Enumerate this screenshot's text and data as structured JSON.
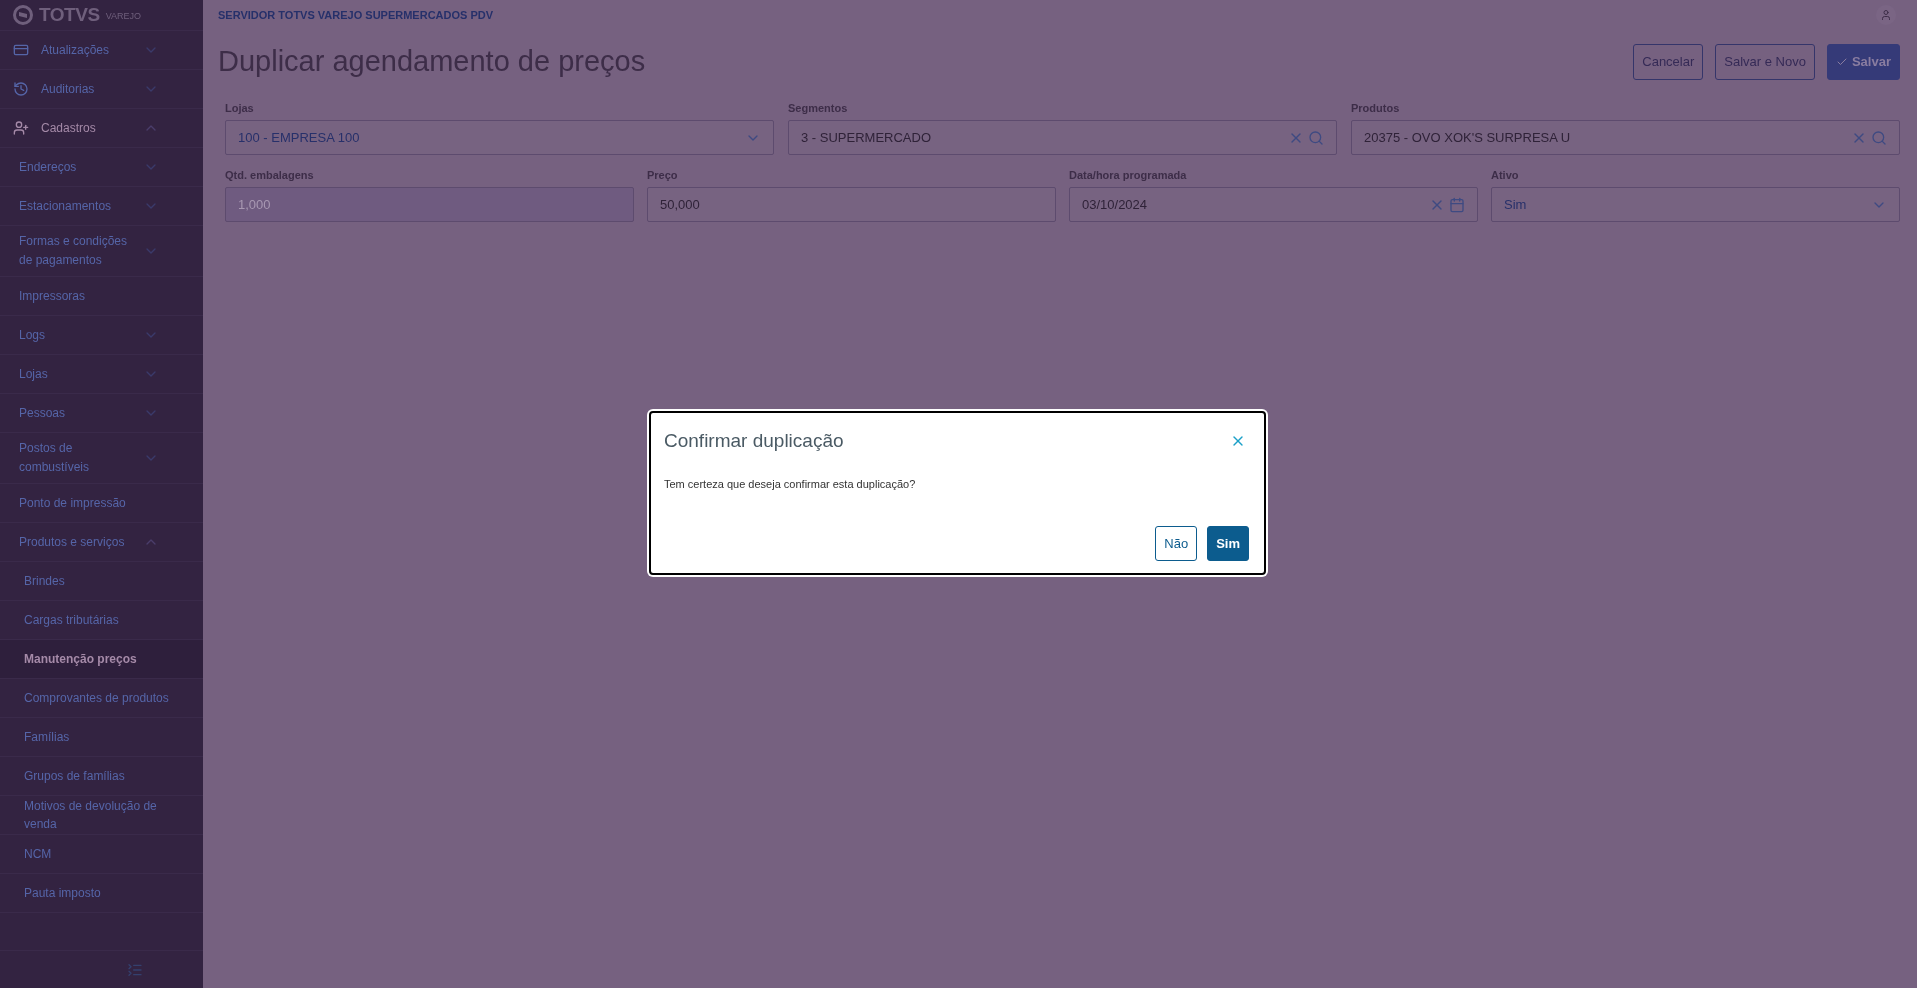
{
  "brand": {
    "name": "TOTVS",
    "product": "VAREJO"
  },
  "sidebar": {
    "items": [
      {
        "label": "Atualizações",
        "kind": "group",
        "expanded": false
      },
      {
        "label": "Auditorias",
        "kind": "group",
        "expanded": false
      },
      {
        "label": "Cadastros",
        "kind": "group",
        "expanded": true,
        "children": [
          {
            "label": "Endereços",
            "expanded": false
          },
          {
            "label": "Estacionamentos",
            "expanded": false
          },
          {
            "label": "Formas e condições de pagamentos",
            "expanded": false
          },
          {
            "label": "Impressoras"
          },
          {
            "label": "Logs",
            "expanded": false
          },
          {
            "label": "Lojas",
            "expanded": false
          },
          {
            "label": "Pessoas",
            "expanded": false
          },
          {
            "label": "Postos de combustíveis",
            "expanded": false
          },
          {
            "label": "Ponto de impressão"
          },
          {
            "label": "Produtos e serviços",
            "expanded": true,
            "children": [
              {
                "label": "Brindes",
                "selected": false
              },
              {
                "label": "Cargas tributárias",
                "selected": false
              },
              {
                "label": "Manutenção preços",
                "selected": true
              },
              {
                "label": "Comprovantes de produtos",
                "selected": false
              },
              {
                "label": "Famílias",
                "selected": false
              },
              {
                "label": "Grupos de famílias",
                "selected": false
              },
              {
                "label": "Motivos de devolução de venda",
                "selected": false
              },
              {
                "label": "NCM",
                "selected": false
              },
              {
                "label": "Pauta imposto",
                "selected": false
              }
            ]
          }
        ]
      }
    ]
  },
  "header": {
    "server": "SERVIDOR TOTVS VAREJO SUPERMERCADOS PDV"
  },
  "page": {
    "title": "Duplicar agendamento de preços",
    "buttons": [
      {
        "label": "Cancelar",
        "kind": "secondary"
      },
      {
        "label": "Salvar e Novo",
        "kind": "secondary"
      },
      {
        "label": "Salvar",
        "kind": "primary"
      }
    ]
  },
  "form": {
    "filters": [
      {
        "label": "Lojas",
        "value": "100 - EMPRESA 100",
        "kind": "select",
        "disabled": false
      },
      {
        "label": "Segmentos",
        "value": "3 - SUPERMERCADO",
        "kind": "lookup",
        "disabled": false
      },
      {
        "label": "Produtos",
        "value": "20375 - OVO XOK'S SURPRESA U",
        "kind": "lookup",
        "disabled": false
      }
    ],
    "details": [
      {
        "label": "Qtd. embalagens",
        "value": "1,000",
        "kind": "text",
        "disabled": true
      },
      {
        "label": "Preço",
        "value": "50,000",
        "kind": "text",
        "disabled": false
      },
      {
        "label": "Data/hora programada",
        "value": "03/10/2024",
        "kind": "date",
        "disabled": false
      },
      {
        "label": "Ativo",
        "value": "Sim",
        "kind": "select",
        "disabled": false
      }
    ]
  },
  "dialog": {
    "title": "Confirmar duplicação",
    "message": "Tem certeza que deseja confirmar esta duplicação?",
    "buttons": [
      {
        "label": "Não",
        "kind": "secondary"
      },
      {
        "label": "Sim",
        "kind": "primary"
      }
    ]
  }
}
